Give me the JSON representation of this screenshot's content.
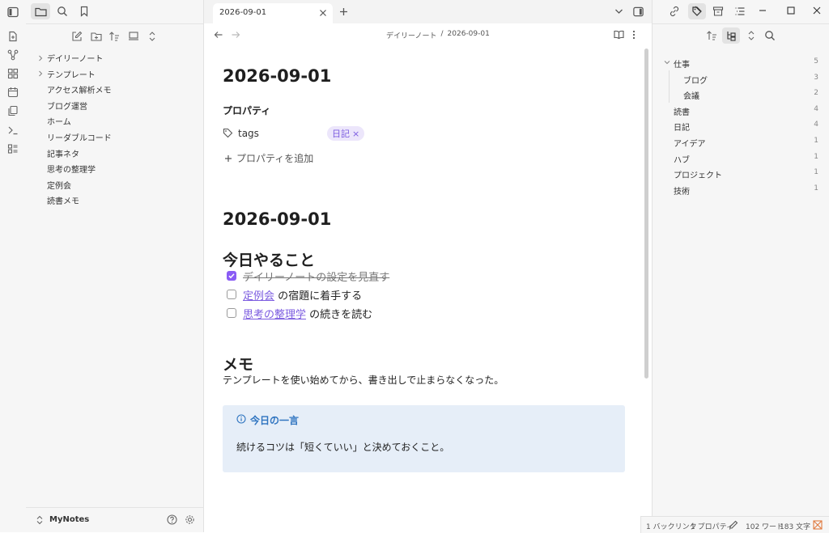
{
  "app": {
    "vault_name": "MyNotes"
  },
  "ribbon": {
    "icons": [
      "open-vault-icon",
      "graph-view-icon",
      "canvas-icon",
      "daily-notes-icon",
      "templates-icon",
      "command-palette-icon",
      "bases-icon"
    ]
  },
  "left_sidebar": {
    "tabs": [
      "files-tab",
      "search-tab",
      "bookmarks-tab"
    ],
    "toolbar_icons": [
      "new-note-icon",
      "new-folder-icon",
      "sort-icon",
      "auto-reveal-icon",
      "collapse-all-icon"
    ],
    "items": [
      {
        "label": "デイリーノート",
        "folder": true
      },
      {
        "label": "テンプレート",
        "folder": true
      },
      {
        "label": "アクセス解析メモ",
        "folder": false
      },
      {
        "label": "ブログ運営",
        "folder": false
      },
      {
        "label": "ホーム",
        "folder": false
      },
      {
        "label": "リーダブルコード",
        "folder": false
      },
      {
        "label": "記事ネタ",
        "folder": false
      },
      {
        "label": "思考の整理学",
        "folder": false
      },
      {
        "label": "定例会",
        "folder": false
      },
      {
        "label": "読書メモ",
        "folder": false
      }
    ]
  },
  "tabs": [
    {
      "label": "2026-09-01",
      "active": true
    }
  ],
  "breadcrumb": {
    "folder": "デイリーノート",
    "separator": "/",
    "file": "2026-09-01"
  },
  "note": {
    "inline_title": "2026-09-01",
    "properties": {
      "heading": "プロパティ",
      "items": [
        {
          "key": "tags",
          "value": "日記",
          "remove": "×"
        }
      ],
      "add_label": "プロパティを追加"
    },
    "h1": "2026-09-01",
    "tasks_heading": "今日やること",
    "tasks": [
      {
        "checked": true,
        "link": "",
        "text": "デイリーノートの設定を見直す"
      },
      {
        "checked": false,
        "link": "定例会",
        "text": " の宿題に着手する"
      },
      {
        "checked": false,
        "link": "思考の整理学",
        "text": " の続きを読む"
      }
    ],
    "memo_heading": "メモ",
    "memo_text": "テンプレートを使い始めてから、書き出しで止まらなくなった。",
    "callout": {
      "title": "今日の一言",
      "text": "続けるコツは「短くていい」と決めておくこと。"
    }
  },
  "right_sidebar": {
    "tags": [
      {
        "label": "仕事",
        "count": "5",
        "level": 0,
        "expandable": true
      },
      {
        "label": "ブログ",
        "count": "3",
        "level": 1,
        "expandable": false
      },
      {
        "label": "会議",
        "count": "2",
        "level": 1,
        "expandable": false
      },
      {
        "label": "読書",
        "count": "4",
        "level": 0,
        "expandable": false
      },
      {
        "label": "日記",
        "count": "4",
        "level": 0,
        "expandable": false
      },
      {
        "label": "アイデア",
        "count": "1",
        "level": 0,
        "expandable": false
      },
      {
        "label": "ハブ",
        "count": "1",
        "level": 0,
        "expandable": false
      },
      {
        "label": "プロジェクト",
        "count": "1",
        "level": 0,
        "expandable": false
      },
      {
        "label": "技術",
        "count": "1",
        "level": 0,
        "expandable": false
      }
    ]
  },
  "status_bar": {
    "backlinks": "1 バックリンク",
    "properties": "1 プロパティ",
    "words": "102 ワード",
    "chars": "183 文字"
  },
  "colors": {
    "accent": "#8a5cf5",
    "link": "#7c5ce0",
    "callout_bg": "#e6eef8",
    "callout_title": "#2f74c0",
    "tag_bg": "#ece6fb"
  }
}
